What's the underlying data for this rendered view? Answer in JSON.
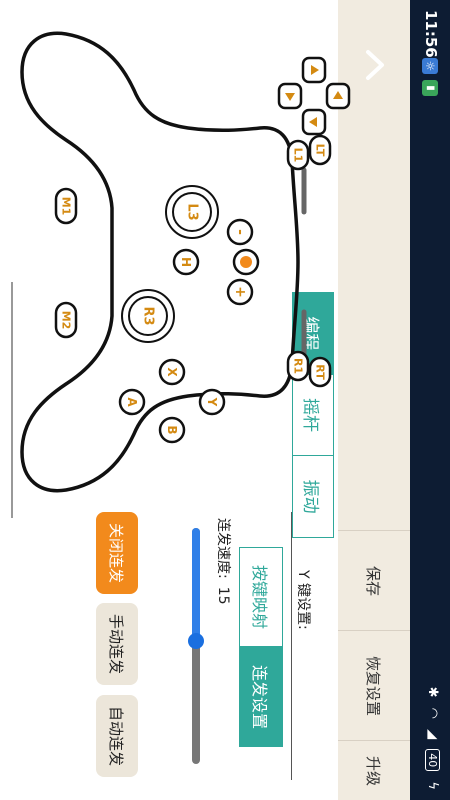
{
  "status_bar": {
    "time": "11:56",
    "battery_text": "40",
    "icons": [
      "notification-icon",
      "sim-icon",
      "bluetooth-icon",
      "wifi-icon",
      "signal-icon",
      "battery-icon",
      "charging-icon"
    ]
  },
  "sidebar": {
    "back_icon": "chevron-up-icon",
    "save": "保存",
    "restore": "恢复设置",
    "upgrade": "升级"
  },
  "tabs": [
    {
      "label": "编程",
      "active": true
    },
    {
      "label": "摇杆",
      "active": false
    },
    {
      "label": "振动",
      "active": false
    }
  ],
  "panel": {
    "key_setting_label": "Y 键设置:",
    "mode_buttons": [
      {
        "label": "按键映射",
        "active": false
      },
      {
        "label": "连发设置",
        "active": true
      }
    ],
    "speed_label": "连发速度:",
    "speed_value": "15",
    "speed_level_fraction": 0.48,
    "burst_buttons": [
      {
        "label": "关闭连发",
        "active": true
      },
      {
        "label": "手动连发",
        "active": false
      },
      {
        "label": "自动连发",
        "active": false
      }
    ]
  },
  "controller": {
    "buttons": {
      "LT": "LT",
      "L1": "L1",
      "RT": "RT",
      "R1": "R1",
      "M1": "M1",
      "M2": "M2",
      "L3": "L3",
      "R3": "R3",
      "H": "H",
      "minus": "-",
      "plus": "+",
      "X": "X",
      "Y": "Y",
      "A": "A",
      "B": "B"
    }
  },
  "colors": {
    "accent": "#2fa89a",
    "orange": "#f28a1c",
    "slider": "#2f7fe8",
    "status_bar": "#0d1c33",
    "sidebar": "#f1ebe0"
  }
}
